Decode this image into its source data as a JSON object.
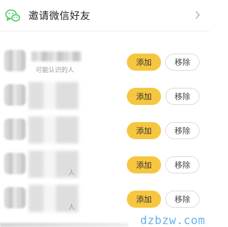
{
  "invite": {
    "label": "邀请微信好友",
    "icon": "wechat-icon",
    "accent": "#4cc95e"
  },
  "friends": [
    {
      "subtitle": "可能认识的人",
      "add_label": "添加",
      "remove_label": "移除"
    },
    {
      "subtitle": "",
      "add_label": "添加",
      "remove_label": "移除"
    },
    {
      "subtitle": "",
      "add_label": "添加",
      "remove_label": "移除"
    },
    {
      "subtitle": "人",
      "add_label": "添加",
      "remove_label": "移除"
    },
    {
      "subtitle": "人",
      "add_label": "添加",
      "remove_label": "移除"
    }
  ],
  "colors": {
    "add_button": "#f7c640",
    "remove_border": "#dcdcdc"
  },
  "watermark": "dzbzw.com"
}
